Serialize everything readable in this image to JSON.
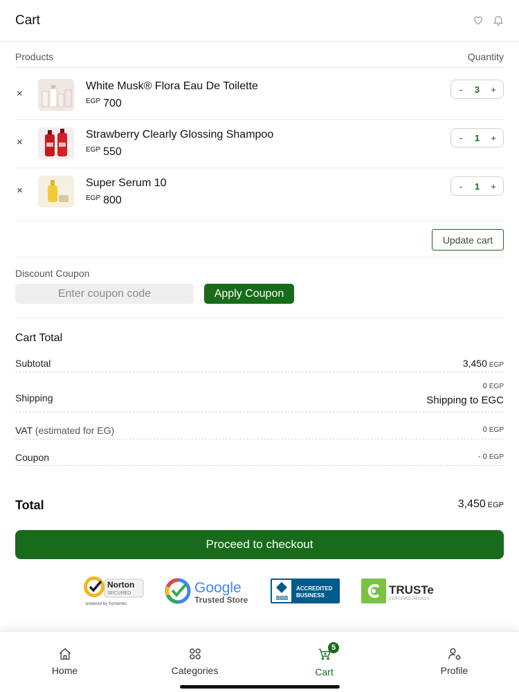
{
  "header": {
    "title": "Cart",
    "icons": [
      "heart-icon",
      "bell-icon"
    ]
  },
  "columns": {
    "products": "Products",
    "quantity": "Quantity"
  },
  "items": [
    {
      "name": "White Musk® Flora Eau De Toilette",
      "currency": "EGP",
      "price": "700",
      "qty": "3",
      "minus": "-",
      "plus": "+",
      "remove": "×"
    },
    {
      "name": "Strawberry Clearly Glossing Shampoo",
      "currency": "EGP",
      "price": "550",
      "qty": "1",
      "minus": "-",
      "plus": "+",
      "remove": "×"
    },
    {
      "name": "Super Serum 10",
      "currency": "EGP",
      "price": "800",
      "qty": "1",
      "minus": "-",
      "plus": "+",
      "remove": "×"
    }
  ],
  "update_cart": "Update cart",
  "coupon": {
    "label": "Discount Coupon",
    "placeholder": "Enter coupon code",
    "apply": "Apply Coupon"
  },
  "totals": {
    "title": "Cart Total",
    "subtotal_label": "Subtotal",
    "subtotal_value": "3,450",
    "subtotal_currency": "EGP",
    "shipping_label": "Shipping",
    "shipping_value": "0",
    "shipping_currency": "EGP",
    "shipping_note": "Shipping to EGC",
    "vat_label": "VAT",
    "vat_note": "(estimated for EG)",
    "vat_value": "0",
    "vat_currency": "EGP",
    "coupon_label": "Coupon",
    "coupon_value": "- 0",
    "coupon_currency": "EGP",
    "total_label": "Total",
    "total_value": "3,450",
    "total_currency": "EGP"
  },
  "checkout": "Proceed to checkout",
  "trust_badges": {
    "norton": {
      "line1": "Norton",
      "line2": "SECURED",
      "line3": "powered by Symantec"
    },
    "google": {
      "line1": "Google",
      "line2": "Trusted Store"
    },
    "bbb": {
      "mark": "BBB",
      "line1": "ACCREDITED",
      "line2": "BUSINESS"
    },
    "truste": {
      "line1": "TRUSTe",
      "line2": "CERTIFIED PRIVACY"
    }
  },
  "tabs": [
    {
      "label": "Home",
      "icon": "home-icon"
    },
    {
      "label": "Categories",
      "icon": "grid-icon"
    },
    {
      "label": "Cart",
      "icon": "cart-icon",
      "badge": "5"
    },
    {
      "label": "Profile",
      "icon": "profile-gear-icon"
    }
  ],
  "colors": {
    "primary": "#176b1a",
    "text": "#111111",
    "muted": "#555555"
  }
}
